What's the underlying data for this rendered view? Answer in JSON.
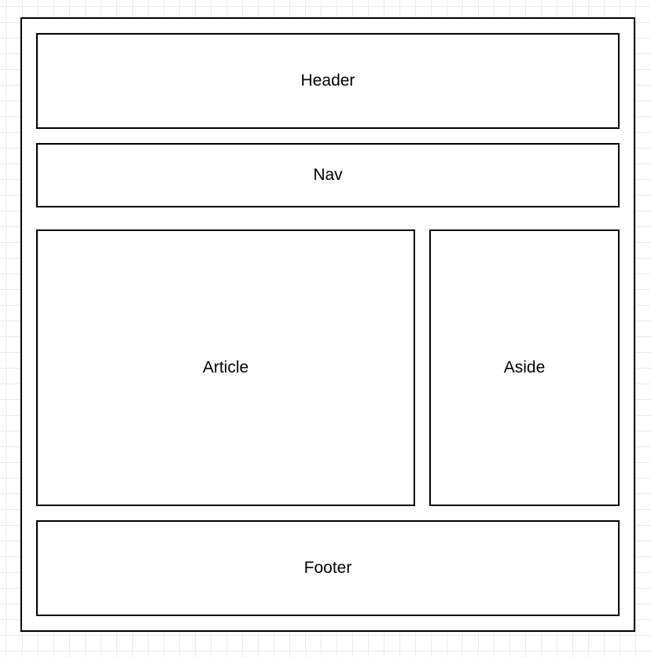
{
  "diagram": {
    "blocks": {
      "header": "Header",
      "nav": "Nav",
      "article": "Article",
      "aside": "Aside",
      "footer": "Footer"
    }
  }
}
